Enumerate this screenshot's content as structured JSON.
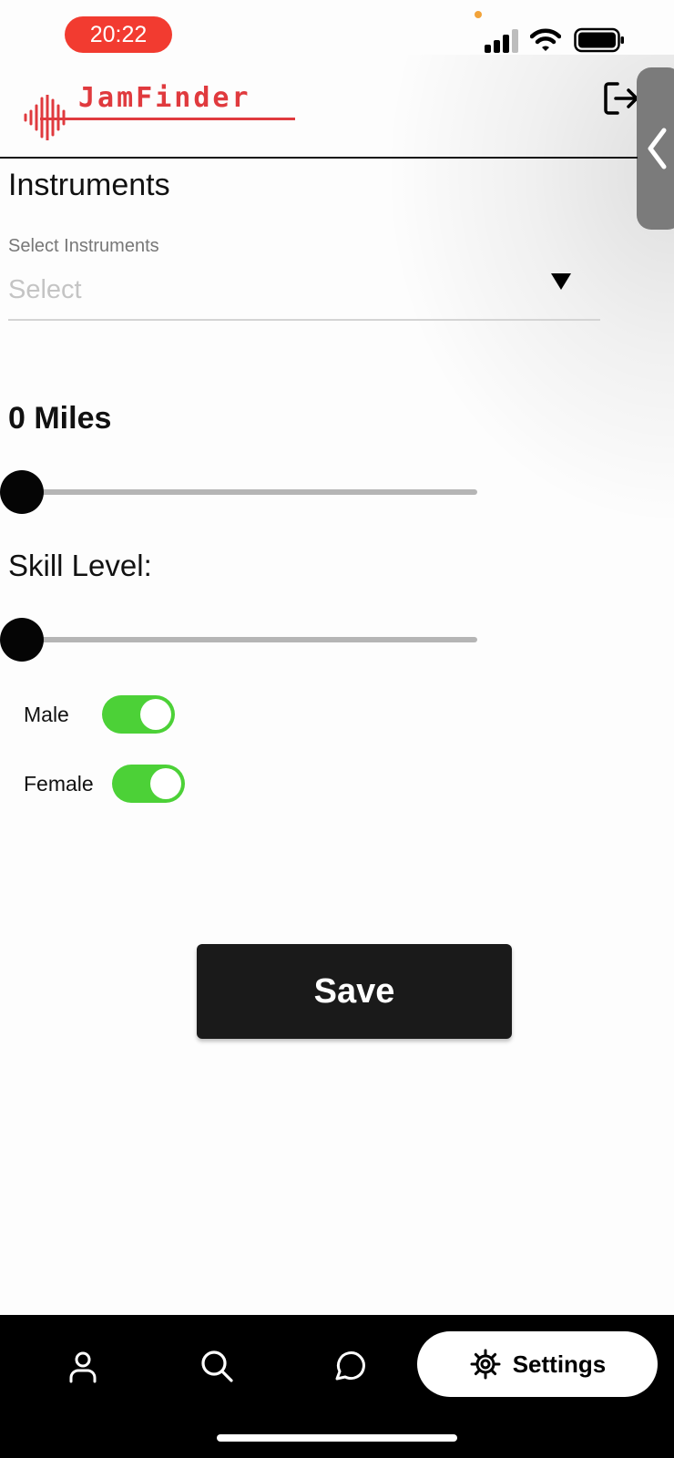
{
  "status_bar": {
    "time": "20:22",
    "icons": [
      "signal-icon",
      "wifi-icon",
      "battery-icon"
    ],
    "time_pill_color": "#f23b30"
  },
  "header": {
    "logo_text": "JamFinder",
    "logo_color": "#e03a3e",
    "logout_icon": "logout-icon",
    "side_tab_icon": "chevron-left-icon"
  },
  "form": {
    "section_title": "Instruments",
    "instruments_label": "Select Instruments",
    "instruments_placeholder": "Select",
    "distance": {
      "label": "0 Miles",
      "value": 0
    },
    "skill": {
      "label": "Skill Level:",
      "value": 0
    },
    "toggles": [
      {
        "label": "Male",
        "on": true
      },
      {
        "label": "Female",
        "on": true
      }
    ],
    "toggle_color": "#4cd137",
    "save_label": "Save"
  },
  "bottom_nav": {
    "items": [
      {
        "icon": "user-icon"
      },
      {
        "icon": "search-icon"
      },
      {
        "icon": "chat-icon"
      },
      {
        "icon": "gear-icon",
        "label": "Settings",
        "active": true
      }
    ]
  }
}
